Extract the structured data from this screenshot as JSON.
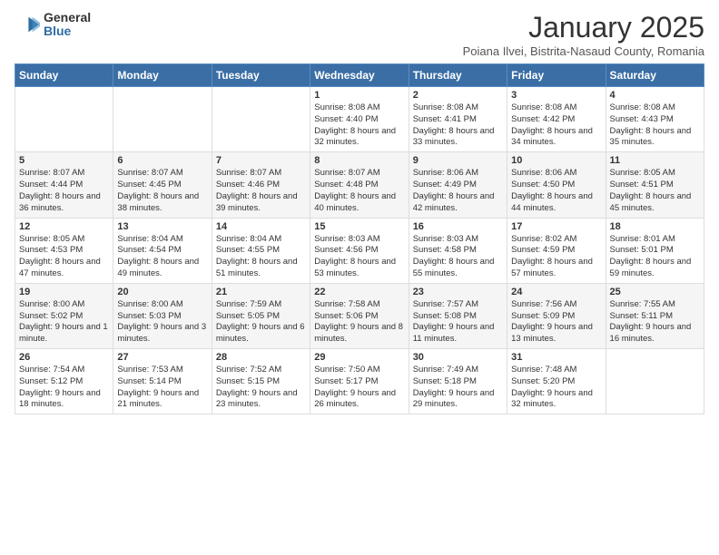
{
  "header": {
    "logo_general": "General",
    "logo_blue": "Blue",
    "month_title": "January 2025",
    "subtitle": "Poiana Ilvei, Bistrita-Nasaud County, Romania"
  },
  "weekdays": [
    "Sunday",
    "Monday",
    "Tuesday",
    "Wednesday",
    "Thursday",
    "Friday",
    "Saturday"
  ],
  "weeks": [
    [
      {
        "day": "",
        "info": ""
      },
      {
        "day": "",
        "info": ""
      },
      {
        "day": "",
        "info": ""
      },
      {
        "day": "1",
        "info": "Sunrise: 8:08 AM\nSunset: 4:40 PM\nDaylight: 8 hours and 32 minutes."
      },
      {
        "day": "2",
        "info": "Sunrise: 8:08 AM\nSunset: 4:41 PM\nDaylight: 8 hours and 33 minutes."
      },
      {
        "day": "3",
        "info": "Sunrise: 8:08 AM\nSunset: 4:42 PM\nDaylight: 8 hours and 34 minutes."
      },
      {
        "day": "4",
        "info": "Sunrise: 8:08 AM\nSunset: 4:43 PM\nDaylight: 8 hours and 35 minutes."
      }
    ],
    [
      {
        "day": "5",
        "info": "Sunrise: 8:07 AM\nSunset: 4:44 PM\nDaylight: 8 hours and 36 minutes."
      },
      {
        "day": "6",
        "info": "Sunrise: 8:07 AM\nSunset: 4:45 PM\nDaylight: 8 hours and 38 minutes."
      },
      {
        "day": "7",
        "info": "Sunrise: 8:07 AM\nSunset: 4:46 PM\nDaylight: 8 hours and 39 minutes."
      },
      {
        "day": "8",
        "info": "Sunrise: 8:07 AM\nSunset: 4:48 PM\nDaylight: 8 hours and 40 minutes."
      },
      {
        "day": "9",
        "info": "Sunrise: 8:06 AM\nSunset: 4:49 PM\nDaylight: 8 hours and 42 minutes."
      },
      {
        "day": "10",
        "info": "Sunrise: 8:06 AM\nSunset: 4:50 PM\nDaylight: 8 hours and 44 minutes."
      },
      {
        "day": "11",
        "info": "Sunrise: 8:05 AM\nSunset: 4:51 PM\nDaylight: 8 hours and 45 minutes."
      }
    ],
    [
      {
        "day": "12",
        "info": "Sunrise: 8:05 AM\nSunset: 4:53 PM\nDaylight: 8 hours and 47 minutes."
      },
      {
        "day": "13",
        "info": "Sunrise: 8:04 AM\nSunset: 4:54 PM\nDaylight: 8 hours and 49 minutes."
      },
      {
        "day": "14",
        "info": "Sunrise: 8:04 AM\nSunset: 4:55 PM\nDaylight: 8 hours and 51 minutes."
      },
      {
        "day": "15",
        "info": "Sunrise: 8:03 AM\nSunset: 4:56 PM\nDaylight: 8 hours and 53 minutes."
      },
      {
        "day": "16",
        "info": "Sunrise: 8:03 AM\nSunset: 4:58 PM\nDaylight: 8 hours and 55 minutes."
      },
      {
        "day": "17",
        "info": "Sunrise: 8:02 AM\nSunset: 4:59 PM\nDaylight: 8 hours and 57 minutes."
      },
      {
        "day": "18",
        "info": "Sunrise: 8:01 AM\nSunset: 5:01 PM\nDaylight: 8 hours and 59 minutes."
      }
    ],
    [
      {
        "day": "19",
        "info": "Sunrise: 8:00 AM\nSunset: 5:02 PM\nDaylight: 9 hours and 1 minute."
      },
      {
        "day": "20",
        "info": "Sunrise: 8:00 AM\nSunset: 5:03 PM\nDaylight: 9 hours and 3 minutes."
      },
      {
        "day": "21",
        "info": "Sunrise: 7:59 AM\nSunset: 5:05 PM\nDaylight: 9 hours and 6 minutes."
      },
      {
        "day": "22",
        "info": "Sunrise: 7:58 AM\nSunset: 5:06 PM\nDaylight: 9 hours and 8 minutes."
      },
      {
        "day": "23",
        "info": "Sunrise: 7:57 AM\nSunset: 5:08 PM\nDaylight: 9 hours and 11 minutes."
      },
      {
        "day": "24",
        "info": "Sunrise: 7:56 AM\nSunset: 5:09 PM\nDaylight: 9 hours and 13 minutes."
      },
      {
        "day": "25",
        "info": "Sunrise: 7:55 AM\nSunset: 5:11 PM\nDaylight: 9 hours and 16 minutes."
      }
    ],
    [
      {
        "day": "26",
        "info": "Sunrise: 7:54 AM\nSunset: 5:12 PM\nDaylight: 9 hours and 18 minutes."
      },
      {
        "day": "27",
        "info": "Sunrise: 7:53 AM\nSunset: 5:14 PM\nDaylight: 9 hours and 21 minutes."
      },
      {
        "day": "28",
        "info": "Sunrise: 7:52 AM\nSunset: 5:15 PM\nDaylight: 9 hours and 23 minutes."
      },
      {
        "day": "29",
        "info": "Sunrise: 7:50 AM\nSunset: 5:17 PM\nDaylight: 9 hours and 26 minutes."
      },
      {
        "day": "30",
        "info": "Sunrise: 7:49 AM\nSunset: 5:18 PM\nDaylight: 9 hours and 29 minutes."
      },
      {
        "day": "31",
        "info": "Sunrise: 7:48 AM\nSunset: 5:20 PM\nDaylight: 9 hours and 32 minutes."
      },
      {
        "day": "",
        "info": ""
      }
    ]
  ]
}
